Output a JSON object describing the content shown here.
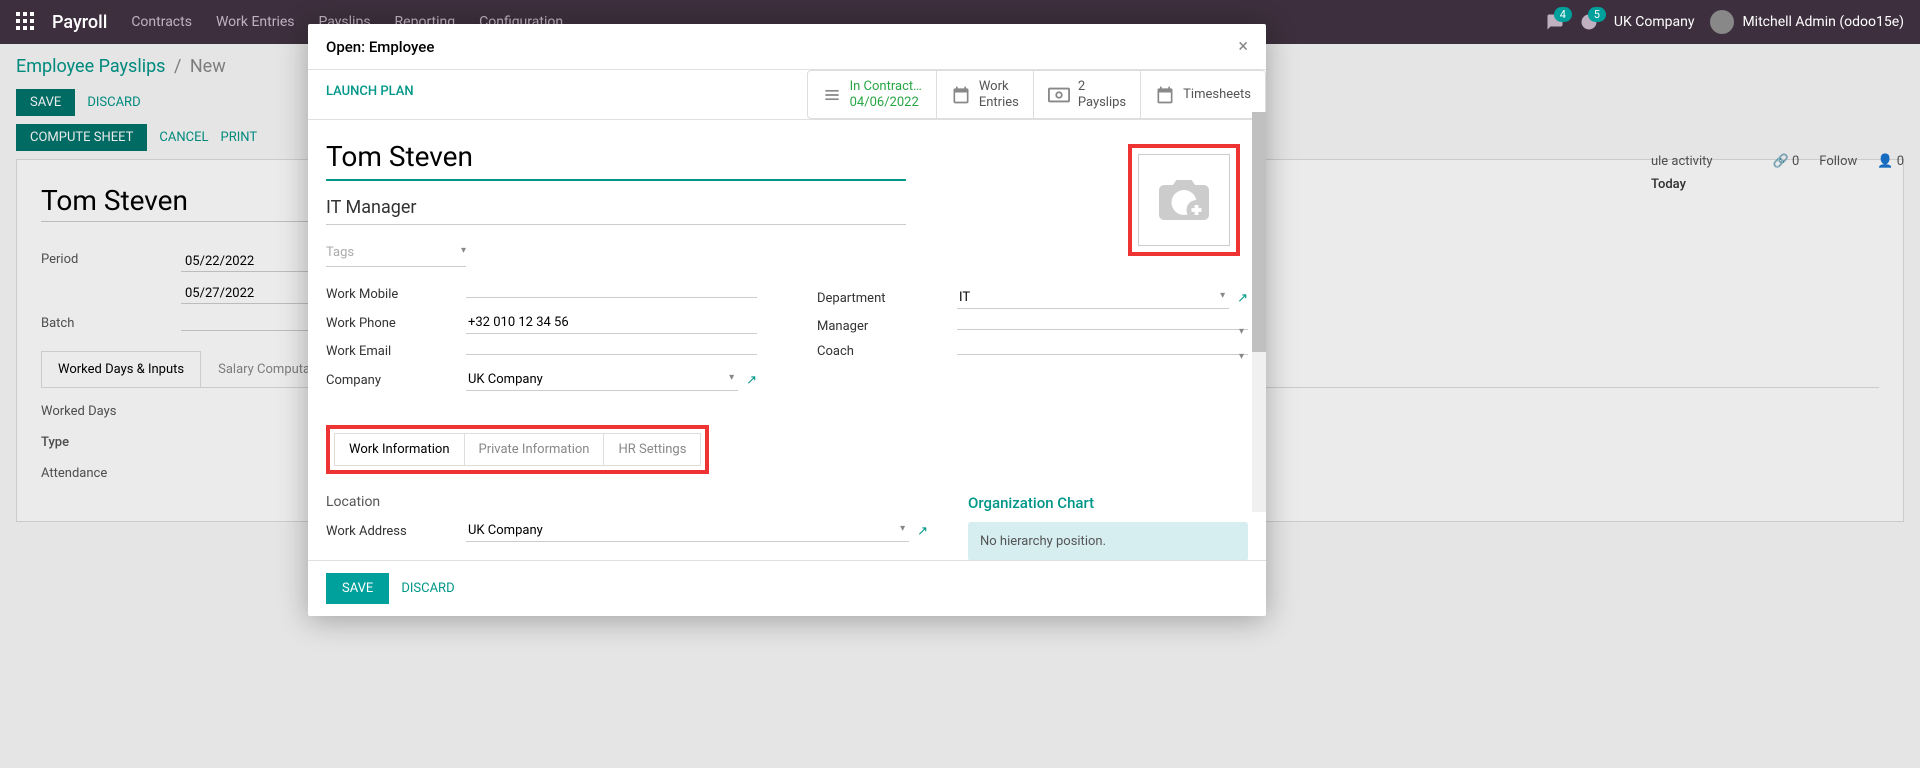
{
  "navbar": {
    "app": "Payroll",
    "menus": [
      "Contracts",
      "Work Entries",
      "Payslips",
      "Reporting",
      "Configuration"
    ],
    "badge1": "4",
    "badge2": "5",
    "company": "UK Company",
    "user": "Mitchell Admin (odoo15e)"
  },
  "bg": {
    "breadcrumb_root": "Employee Payslips",
    "breadcrumb_current": "New",
    "save": "SAVE",
    "discard": "DISCARD",
    "compute": "COMPUTE SHEET",
    "cancel": "CANCEL",
    "print": "PRINT",
    "name": "Tom Steven",
    "period_label": "Period",
    "period_from": "05/22/2022",
    "period_to": "05/27/2022",
    "batch_label": "Batch",
    "tab_worked": "Worked Days & Inputs",
    "tab_salary": "Salary Computation",
    "worked_days": "Worked Days",
    "type": "Type",
    "attendance": "Attendance",
    "right_activity": "ule activity",
    "right_attach": "0",
    "right_follow": "Follow",
    "right_followers": "0",
    "right_today": "Today"
  },
  "modal": {
    "title": "Open: Employee",
    "launch": "LAUNCH PLAN",
    "stats": {
      "contract_label": "In Contract…",
      "contract_date": "04/06/2022",
      "work_entries": "Work\nEntries",
      "payslips_count": "2",
      "payslips_label": "Payslips",
      "timesheets": "Timesheets"
    },
    "name": "Tom Steven",
    "job_title": "IT Manager",
    "tags_placeholder": "Tags",
    "fields_left": {
      "work_mobile": "Work Mobile",
      "work_mobile_val": "",
      "work_phone": "Work Phone",
      "work_phone_val": "+32 010 12 34 56",
      "work_email": "Work Email",
      "work_email_val": "",
      "company": "Company",
      "company_val": "UK Company"
    },
    "fields_right": {
      "department": "Department",
      "department_val": "IT",
      "manager": "Manager",
      "manager_val": "",
      "coach": "Coach",
      "coach_val": ""
    },
    "tabs": {
      "work_info": "Work Information",
      "private_info": "Private Information",
      "hr_settings": "HR Settings"
    },
    "location_head": "Location",
    "work_address": "Work Address",
    "work_address_val": "UK Company",
    "org_chart": "Organization Chart",
    "no_hierarchy": "No hierarchy position.",
    "save": "SAVE",
    "discard": "DISCARD"
  }
}
